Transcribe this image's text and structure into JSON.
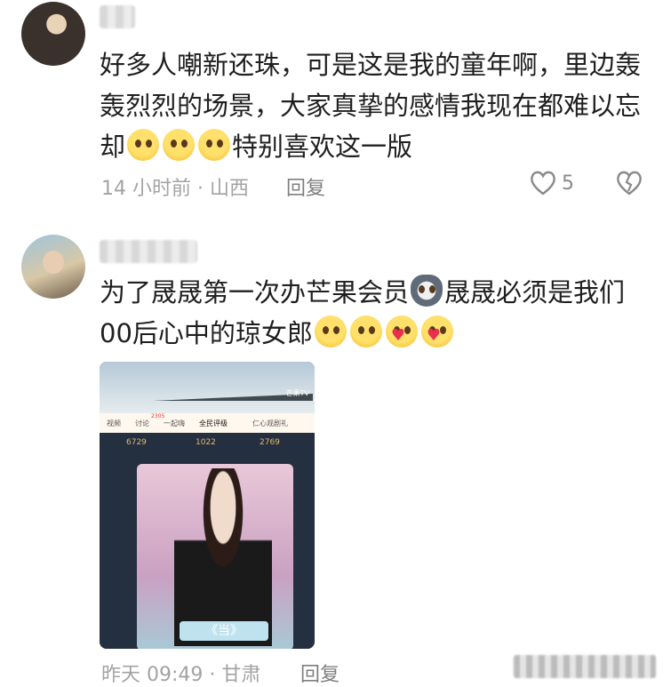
{
  "comments": [
    {
      "text": "好多人嘲新还珠，可是这是我的童年啊，里边轰轰烈烈的场景，大家真挚的感情我现在都难以忘却",
      "text_suffix": "特别喜欢这一版",
      "meta": "14 小时前 · 山西",
      "reply_label": "回复",
      "like_count": "5",
      "icons": [
        "heart-outline-icon",
        "broken-heart-icon"
      ]
    },
    {
      "text_part1": "为了晟晟第一次办芒果会员",
      "text_part2": "晟晟必须是我们00后心中的琼女郎",
      "meta": "昨天 09:49 · 甘肃",
      "reply_label": "回复",
      "image": {
        "tabs": [
          "视频",
          "讨论",
          "一起嗨",
          "全民评级",
          "仁心观剧礼"
        ],
        "tab_badge": "2305",
        "numbers": [
          "6729",
          "1022",
          "2769"
        ],
        "card_title": "《当》",
        "brand": "芒果TV"
      }
    }
  ]
}
